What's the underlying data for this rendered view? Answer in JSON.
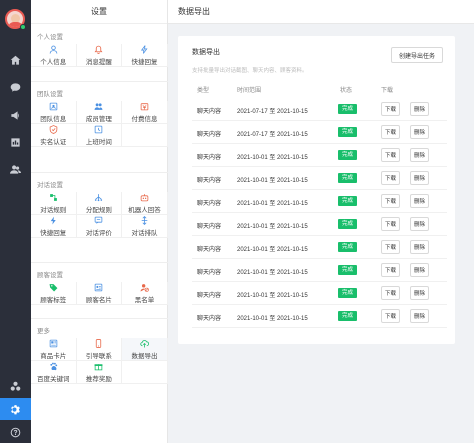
{
  "panel": {
    "title": "设置",
    "groups": [
      {
        "title": "个人设置",
        "items": [
          {
            "label": "个人信息",
            "icon": "user-icon",
            "color": "#4a90e2"
          },
          {
            "label": "消息提醒",
            "icon": "bell-icon",
            "color": "#e8684a"
          },
          {
            "label": "快捷回复",
            "icon": "bolt-icon",
            "color": "#4a90e2"
          }
        ]
      },
      {
        "title": "团队设置",
        "items": [
          {
            "label": "团队信息",
            "icon": "team-icon",
            "color": "#4a90e2"
          },
          {
            "label": "成员管理",
            "icon": "members-icon",
            "color": "#4a90e2"
          },
          {
            "label": "付费信息",
            "icon": "payment-icon",
            "color": "#e8684a"
          },
          {
            "label": "实名认证",
            "icon": "id-card-icon",
            "color": "#e8684a"
          },
          {
            "label": "上班时间",
            "icon": "clock-icon",
            "color": "#4a90e2"
          }
        ]
      },
      {
        "title": "对话设置",
        "items": [
          {
            "label": "对话规则",
            "icon": "rules-icon",
            "color": "#19be6b"
          },
          {
            "label": "分配规则",
            "icon": "distribute-icon",
            "color": "#4a90e2"
          },
          {
            "label": "机器人回答",
            "icon": "robot-icon",
            "color": "#e8684a"
          },
          {
            "label": "快捷回复",
            "icon": "bolt-icon",
            "color": "#4a90e2"
          },
          {
            "label": "对话评价",
            "icon": "rating-icon",
            "color": "#4a90e2"
          },
          {
            "label": "对话排队",
            "icon": "queue-icon",
            "color": "#4a90e2"
          }
        ]
      },
      {
        "title": "顾客设置",
        "items": [
          {
            "label": "顾客标签",
            "icon": "tag-icon",
            "color": "#19be6b"
          },
          {
            "label": "顾客名片",
            "icon": "card-icon",
            "color": "#4a90e2"
          },
          {
            "label": "黑名单",
            "icon": "blacklist-icon",
            "color": "#e8684a"
          }
        ]
      },
      {
        "title": "更多",
        "items": [
          {
            "label": "商品卡片",
            "icon": "product-card-icon",
            "color": "#4a90e2"
          },
          {
            "label": "引导联系",
            "icon": "guide-icon",
            "color": "#e8684a"
          },
          {
            "label": "数据导出",
            "icon": "cloud-export-icon",
            "color": "#19be6b"
          },
          {
            "label": "百度关键词",
            "icon": "paw-icon",
            "color": "#4a90e2"
          },
          {
            "label": "推荐奖励",
            "icon": "gift-icon",
            "color": "#19be6b"
          }
        ]
      }
    ]
  },
  "main": {
    "header_title": "数据导出",
    "card_title": "数据导出",
    "description": "支持批量导出对话截图、聊天内容、顾客资料。",
    "create_button": "创建导出任务",
    "columns": [
      "类型",
      "时间范围",
      "状态",
      "下载"
    ],
    "rows": [
      {
        "type": "聊天内容",
        "range": "2021-07-17 至 2021-10-15",
        "status": "完成",
        "download": "下载",
        "delete": "删除"
      },
      {
        "type": "聊天内容",
        "range": "2021-07-17 至 2021-10-15",
        "status": "完成",
        "download": "下载",
        "delete": "删除"
      },
      {
        "type": "聊天内容",
        "range": "2021-10-01 至 2021-10-15",
        "status": "完成",
        "download": "下载",
        "delete": "删除"
      },
      {
        "type": "聊天内容",
        "range": "2021-10-01 至 2021-10-15",
        "status": "完成",
        "download": "下载",
        "delete": "删除"
      },
      {
        "type": "聊天内容",
        "range": "2021-10-01 至 2021-10-15",
        "status": "完成",
        "download": "下载",
        "delete": "删除"
      },
      {
        "type": "聊天内容",
        "range": "2021-10-01 至 2021-10-15",
        "status": "完成",
        "download": "下载",
        "delete": "删除"
      },
      {
        "type": "聊天内容",
        "range": "2021-10-01 至 2021-10-15",
        "status": "完成",
        "download": "下载",
        "delete": "删除"
      },
      {
        "type": "聊天内容",
        "range": "2021-10-01 至 2021-10-15",
        "status": "完成",
        "download": "下载",
        "delete": "删除"
      },
      {
        "type": "聊天内容",
        "range": "2021-10-01 至 2021-10-15",
        "status": "完成",
        "download": "下载",
        "delete": "删除"
      },
      {
        "type": "聊天内容",
        "range": "2021-10-01 至 2021-10-15",
        "status": "完成",
        "download": "下载",
        "delete": "删除"
      }
    ]
  },
  "rail": {
    "items": [
      "home-icon",
      "chat-icon",
      "broadcast-icon",
      "stats-icon",
      "contacts-icon",
      "apps-icon",
      "settings-icon",
      "help-icon"
    ],
    "active": "settings-icon",
    "active_color": "#2d8cf0"
  }
}
